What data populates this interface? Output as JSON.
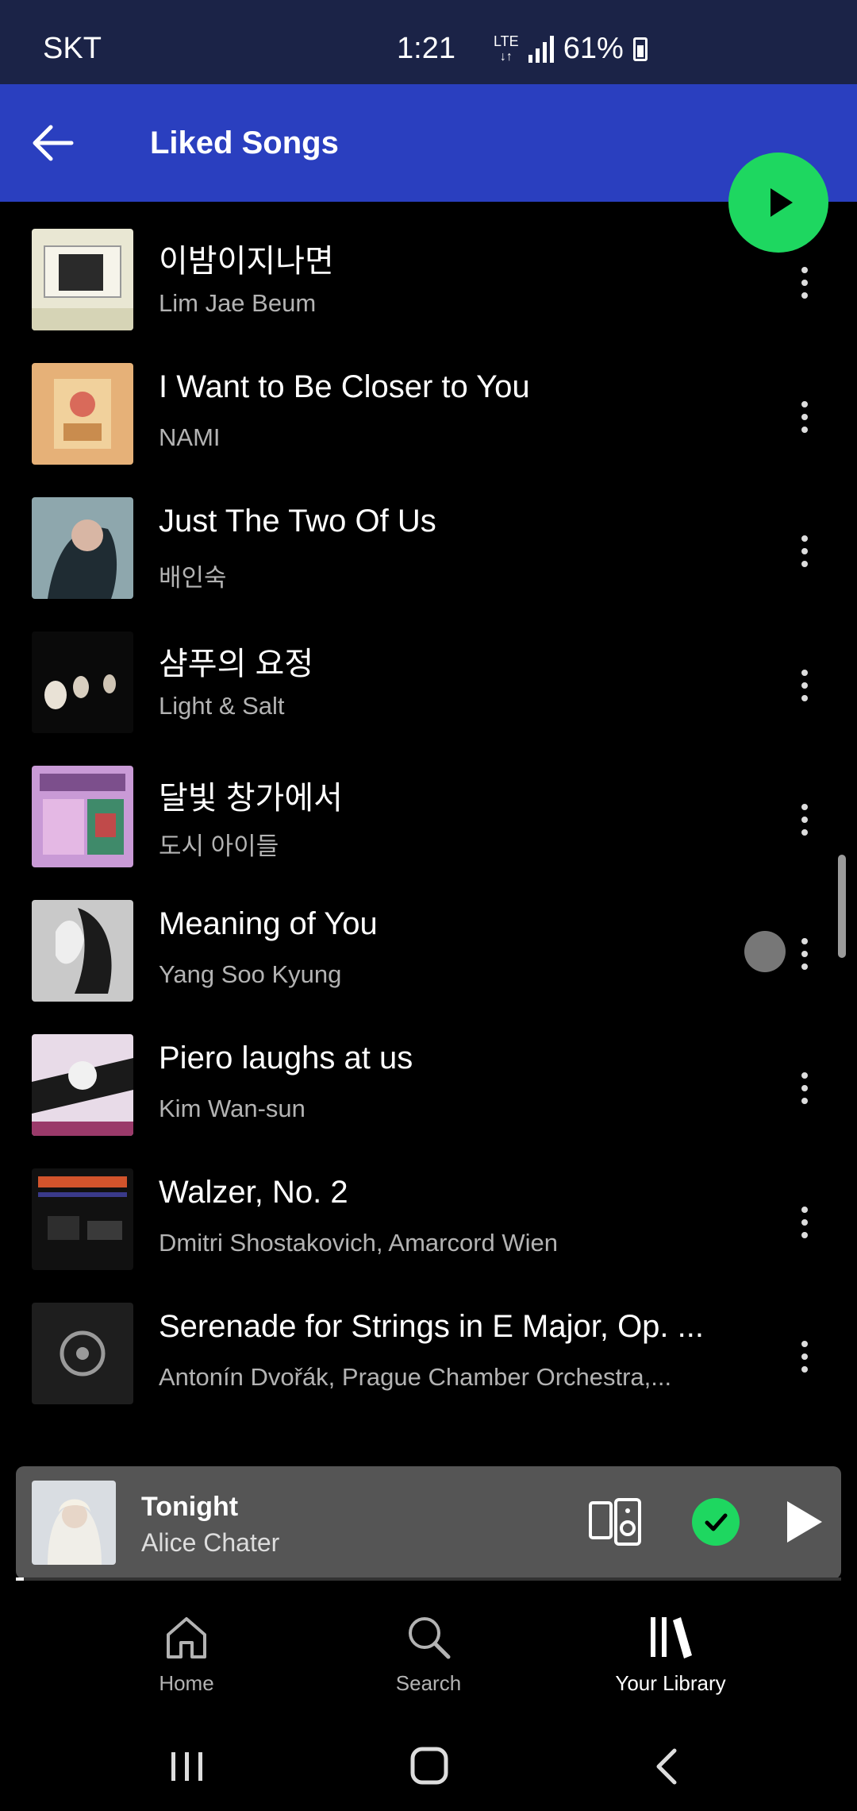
{
  "status_bar": {
    "carrier": "SKT",
    "time": "1:21",
    "network": "LTE",
    "battery": "61%"
  },
  "header": {
    "title": "Liked Songs"
  },
  "tracks": [
    {
      "title": "이밤이지나면",
      "artist": "Lim Jae Beum"
    },
    {
      "title": "I Want to Be Closer to You",
      "artist": "NAMI"
    },
    {
      "title": "Just The Two Of Us",
      "artist": "배인숙"
    },
    {
      "title": "샴푸의 요정",
      "artist": "Light & Salt"
    },
    {
      "title": "달빛 창가에서",
      "artist": "도시 아이들"
    },
    {
      "title": "Meaning of You",
      "artist": "Yang Soo Kyung"
    },
    {
      "title": "Piero laughs at us",
      "artist": "Kim Wan-sun"
    },
    {
      "title": "Walzer, No. 2",
      "artist": "Dmitri Shostakovich, Amarcord Wien"
    },
    {
      "title": "Serenade for Strings in E Major, Op. ...",
      "artist": "Antonín Dvořák, Prague Chamber Orchestra,..."
    }
  ],
  "mini_player": {
    "title": "Tonight",
    "artist": "Alice Chater",
    "progress": 0.01
  },
  "bottom_nav": {
    "items": [
      {
        "label": "Home",
        "icon": "home-icon",
        "active": false
      },
      {
        "label": "Search",
        "icon": "search-icon",
        "active": false
      },
      {
        "label": "Your Library",
        "icon": "library-icon",
        "active": true
      }
    ]
  },
  "colors": {
    "status_bar": "#1b2347",
    "header": "#2a3fbf",
    "accent": "#1ed760",
    "background": "#000000",
    "secondary_text": "#b3b3b3"
  }
}
